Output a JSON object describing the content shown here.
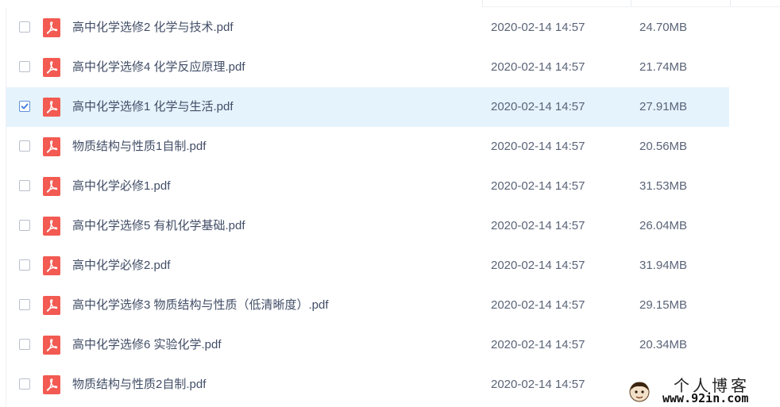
{
  "files": [
    {
      "name": "高中化学选修2 化学与技术.pdf",
      "date": "2020-02-14 14:57",
      "size": "24.70MB",
      "checked": false
    },
    {
      "name": "高中化学选修4 化学反应原理.pdf",
      "date": "2020-02-14 14:57",
      "size": "21.74MB",
      "checked": false
    },
    {
      "name": "高中化学选修1 化学与生活.pdf",
      "date": "2020-02-14 14:57",
      "size": "27.91MB",
      "checked": true
    },
    {
      "name": "物质结构与性质1自制.pdf",
      "date": "2020-02-14 14:57",
      "size": "20.56MB",
      "checked": false
    },
    {
      "name": "高中化学必修1.pdf",
      "date": "2020-02-14 14:57",
      "size": "31.53MB",
      "checked": false
    },
    {
      "name": "高中化学选修5 有机化学基础.pdf",
      "date": "2020-02-14 14:57",
      "size": "26.04MB",
      "checked": false
    },
    {
      "name": "高中化学必修2.pdf",
      "date": "2020-02-14 14:57",
      "size": "31.94MB",
      "checked": false
    },
    {
      "name": "高中化学选修3 物质结构与性质（低清晰度）.pdf",
      "date": "2020-02-14 14:57",
      "size": "29.15MB",
      "checked": false
    },
    {
      "name": "高中化学选修6 实验化学.pdf",
      "date": "2020-02-14 14:57",
      "size": "20.34MB",
      "checked": false
    },
    {
      "name": "物质结构与性质2自制.pdf",
      "date": "2020-02-14 14:57",
      "size": "",
      "checked": false
    }
  ],
  "watermark": {
    "title": "个人博客",
    "url": "www.92in.com"
  },
  "colors": {
    "pdf_icon": "#f25a52",
    "selected_row": "#e5f3fd",
    "checkbox_check": "#3d7ae0"
  }
}
